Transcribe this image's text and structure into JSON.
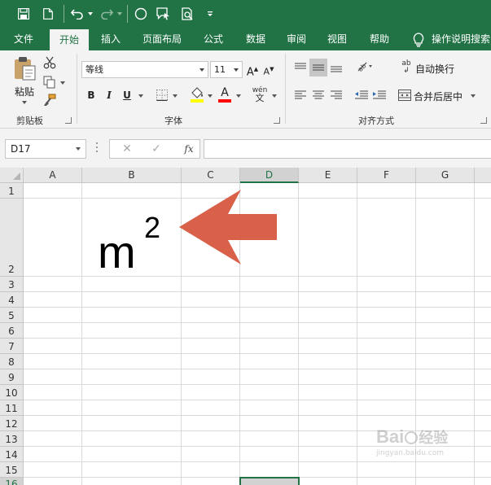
{
  "quick_access": {
    "icons": [
      "save-icon",
      "new-file-icon",
      "undo-icon",
      "redo-icon",
      "circle-shape-icon",
      "comment-icon",
      "print-preview-icon",
      "customize-qat-icon"
    ]
  },
  "ribbon_tabs": [
    {
      "label": "文件",
      "active": false
    },
    {
      "label": "开始",
      "active": true
    },
    {
      "label": "插入",
      "active": false
    },
    {
      "label": "页面布局",
      "active": false
    },
    {
      "label": "公式",
      "active": false
    },
    {
      "label": "数据",
      "active": false
    },
    {
      "label": "审阅",
      "active": false
    },
    {
      "label": "视图",
      "active": false
    },
    {
      "label": "帮助",
      "active": false
    }
  ],
  "tell_me": {
    "label": "操作说明搜索"
  },
  "clipboard": {
    "paste_label": "粘贴",
    "group_label": "剪贴板"
  },
  "font": {
    "name": "等线",
    "size": "11",
    "group_label": "字体",
    "bold": "B",
    "italic": "I",
    "underline": "U",
    "font_color_glyph": "A",
    "phonetic_glyph": "wén",
    "grow_glyph": "A",
    "shrink_glyph": "A",
    "highlight_color": "#ffff00",
    "font_color": "#ff0000"
  },
  "alignment": {
    "wrap_text": "自动换行",
    "merge_center": "合并后居中",
    "group_label": "对齐方式",
    "orientation_glyph": "ab"
  },
  "formula_bar": {
    "name_box": "D17",
    "cancel_glyph": "✕",
    "enter_glyph": "✓",
    "fx_glyph": "fx",
    "value": ""
  },
  "columns": [
    "A",
    "B",
    "C",
    "D",
    "E",
    "F",
    "G"
  ],
  "rows": [
    "1",
    "2",
    "3",
    "4",
    "5",
    "6",
    "7",
    "8",
    "9",
    "10",
    "11",
    "12",
    "13",
    "14",
    "15",
    "16"
  ],
  "selected_column": "D",
  "cell_content": {
    "base": "m",
    "superscript": "2"
  },
  "annotation_arrow_color": "#d9614a",
  "accent_color": "#217346",
  "watermark": {
    "main": "Bai",
    "sub": "经验",
    "url": "jingyan.baidu.com"
  }
}
